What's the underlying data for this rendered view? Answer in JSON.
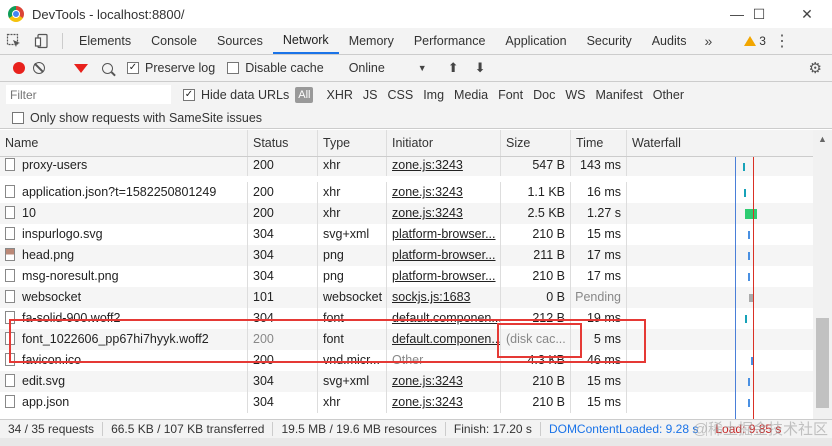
{
  "window": {
    "title": "DevTools - localhost:8800/"
  },
  "tabs": [
    "Elements",
    "Console",
    "Sources",
    "Network",
    "Memory",
    "Performance",
    "Application",
    "Security",
    "Audits"
  ],
  "active_tab": "Network",
  "more_tabs": "»",
  "warnings": "3",
  "toolbar": {
    "preserve_log": "Preserve log",
    "disable_cache": "Disable cache",
    "throttle": "Online"
  },
  "filter": {
    "placeholder": "Filter",
    "hide_data_urls": "Hide data URLs",
    "types": [
      "All",
      "XHR",
      "JS",
      "CSS",
      "Img",
      "Media",
      "Font",
      "Doc",
      "WS",
      "Manifest",
      "Other"
    ],
    "samesite": "Only show requests with SameSite issues"
  },
  "columns": [
    "Name",
    "Status",
    "Type",
    "Initiator",
    "Size",
    "Time",
    "Waterfall"
  ],
  "rows": [
    {
      "name": "proxy-users",
      "status": "200",
      "type": "xhr",
      "initiator": "zone.js:3243",
      "size": "547 B",
      "time": "143 ms"
    },
    {
      "name": "application.json?t=1582250801249",
      "status": "200",
      "type": "xhr",
      "initiator": "zone.js:3243",
      "size": "1.1 KB",
      "time": "16 ms"
    },
    {
      "name": "10",
      "status": "200",
      "type": "xhr",
      "initiator": "zone.js:3243",
      "size": "2.5 KB",
      "time": "1.27 s"
    },
    {
      "name": "inspurlogo.svg",
      "status": "304",
      "type": "svg+xml",
      "initiator": "platform-browser...",
      "size": "210 B",
      "time": "15 ms"
    },
    {
      "name": "head.png",
      "status": "304",
      "type": "png",
      "initiator": "platform-browser...",
      "size": "211 B",
      "time": "17 ms"
    },
    {
      "name": "msg-noresult.png",
      "status": "304",
      "type": "png",
      "initiator": "platform-browser...",
      "size": "210 B",
      "time": "17 ms"
    },
    {
      "name": "websocket",
      "status": "101",
      "type": "websocket",
      "initiator": "sockjs.js:1683",
      "size": "0 B",
      "time": "Pending"
    },
    {
      "name": "fa-solid-900.woff2",
      "status": "304",
      "type": "font",
      "initiator": "default.componen...",
      "size": "212 B",
      "time": "19 ms"
    },
    {
      "name": "font_1022606_pp67hi7hyyk.woff2",
      "status": "200",
      "type": "font",
      "initiator": "default.componen...",
      "size": "(disk cac...",
      "time": "5 ms"
    },
    {
      "name": "favicon.ico",
      "status": "200",
      "type": "vnd.micr...",
      "initiator": "Other",
      "size": "4.3 KB",
      "time": "46 ms"
    },
    {
      "name": "edit.svg",
      "status": "304",
      "type": "svg+xml",
      "initiator": "zone.js:3243",
      "size": "210 B",
      "time": "15 ms"
    },
    {
      "name": "app.json",
      "status": "304",
      "type": "xhr",
      "initiator": "zone.js:3243",
      "size": "210 B",
      "time": "15 ms"
    }
  ],
  "status_bar": {
    "requests": "34 / 35 requests",
    "transferred": "66.5 KB / 107 KB transferred",
    "resources": "19.5 MB / 19.6 MB resources",
    "finish": "Finish: 17.20 s",
    "dcl": "DOMContentLoaded: 9.28 s",
    "load": "Load: 9.85 s"
  },
  "watermark": "@稀土掘金技术社区",
  "colors": {
    "accent": "#1a73e8",
    "record": "#e8211c",
    "highlight": "#e53935",
    "warning": "#f2a600"
  }
}
